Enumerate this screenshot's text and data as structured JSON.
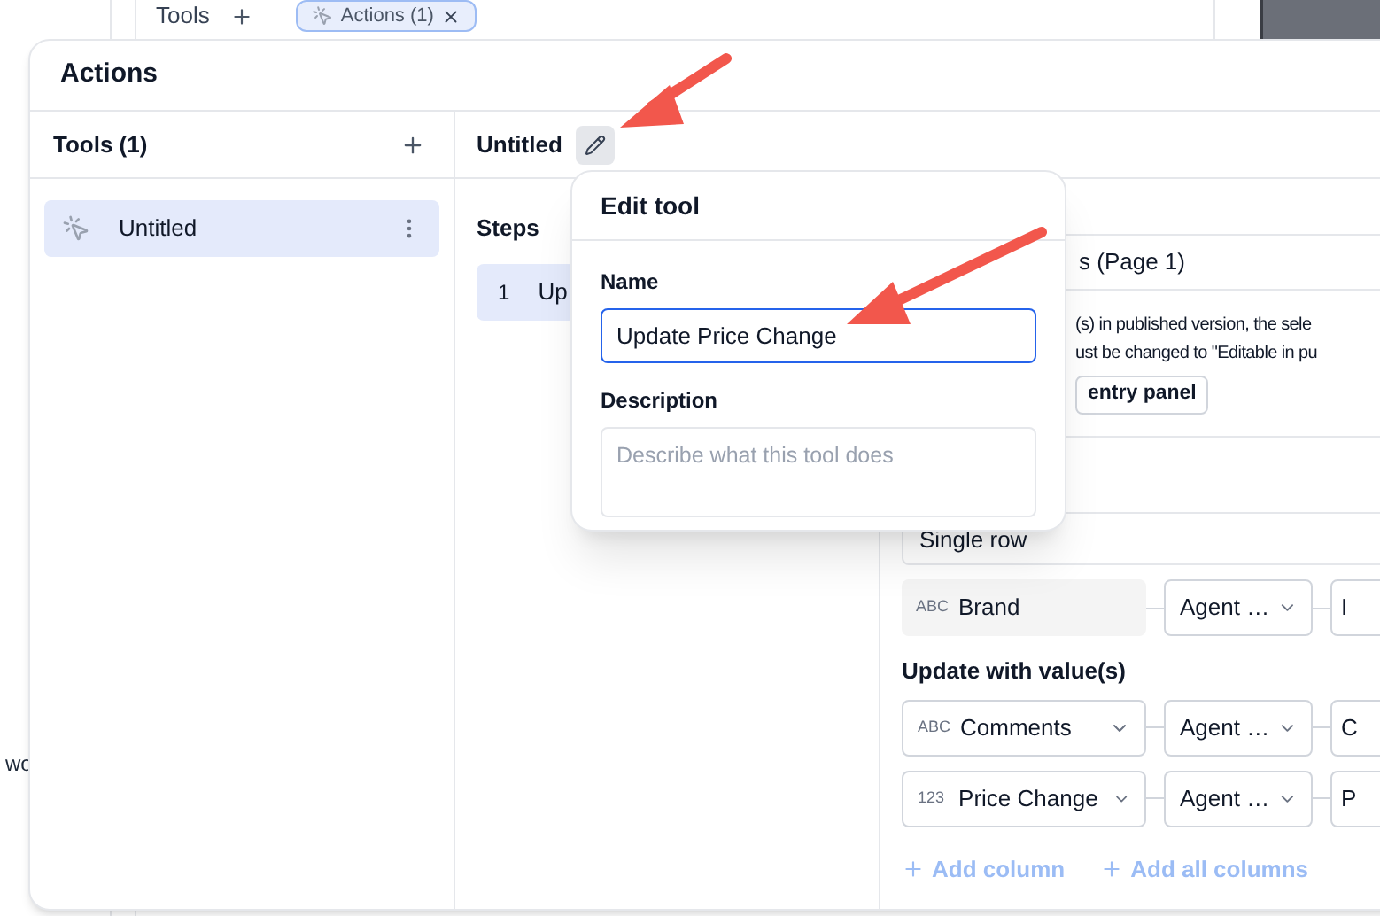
{
  "background": {
    "tools_label": "Tools",
    "chip": {
      "label": "Actions (1)"
    },
    "cut_text": "wo"
  },
  "dialog": {
    "title": "Actions",
    "tools_panel": {
      "title": "Tools (1)",
      "items": [
        {
          "label": "Untitled",
          "selected": true
        }
      ]
    },
    "tool": {
      "name": "Untitled",
      "steps_label": "Steps",
      "steps": [
        {
          "number": "1",
          "label": "Up",
          "selected": true
        }
      ]
    },
    "config": {
      "source": "s (Page 1)",
      "notice_lines": [
        "(s) in published version, the sele",
        "ust be changed to \"Editable in pu"
      ],
      "notice_button": "entry panel",
      "match_mode": "Single row",
      "match_rows": [
        {
          "kind": "fixed",
          "type": "ABC",
          "column": "Brand",
          "source": "Agent …",
          "value": "I"
        }
      ],
      "update_label": "Update with value(s)",
      "update_rows": [
        {
          "kind": "select",
          "type": "ABC",
          "column": "Comments",
          "source": "Agent …",
          "value": "C"
        },
        {
          "kind": "select",
          "type": "123",
          "column": "Price Change",
          "source": "Agent …",
          "value": "P"
        }
      ],
      "add_column": "Add column",
      "add_all": "Add all columns"
    }
  },
  "popover": {
    "title": "Edit tool",
    "name_label": "Name",
    "name_value": "Update Price Change",
    "description_label": "Description",
    "description_placeholder": "Describe what this tool does"
  }
}
